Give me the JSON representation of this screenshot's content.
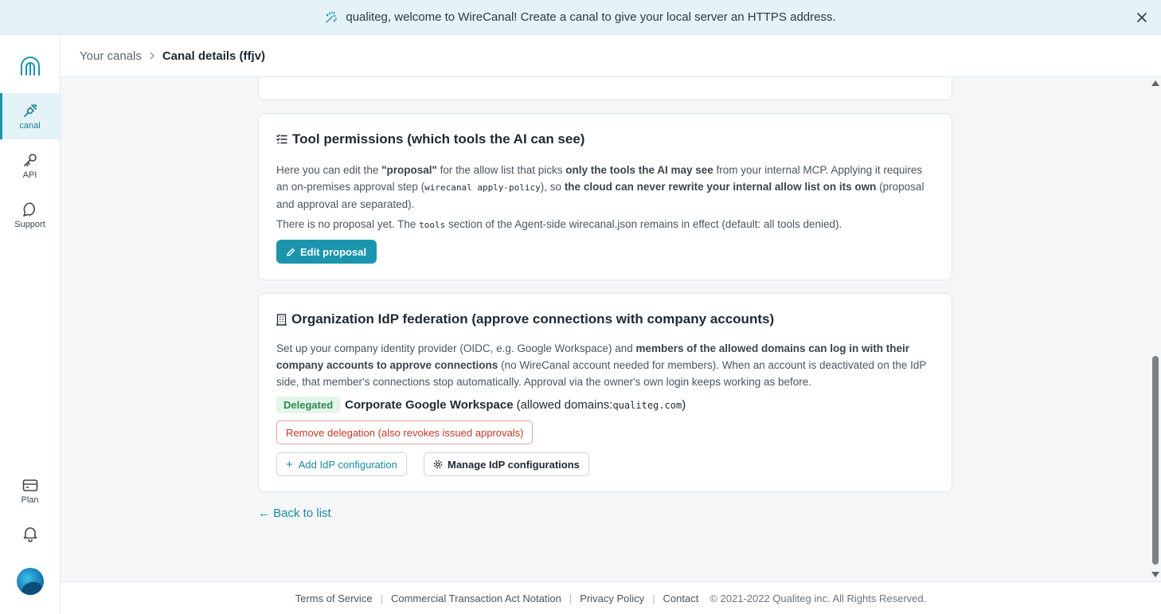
{
  "banner": {
    "message": "qualiteg, welcome to WireCanal! Create a canal to give your local server an HTTPS address."
  },
  "sidebar": {
    "items": [
      {
        "label": "canal",
        "icon": "plug-icon"
      },
      {
        "label": "API",
        "icon": "key-icon"
      },
      {
        "label": "Support",
        "icon": "chat-bubble-icon"
      },
      {
        "label": "Plan",
        "icon": "card-icon"
      }
    ]
  },
  "breadcrumb": {
    "parent": "Your canals",
    "current": "Canal details (ffjv)"
  },
  "tool_permissions": {
    "title": "Tool permissions (which tools the AI can see)",
    "p1_a": "Here you can edit the ",
    "p1_b": "\"proposal\"",
    "p1_c": " for the allow list that picks ",
    "p1_d": "only the tools the AI may see",
    "p1_e": " from your internal MCP. Applying it requires an on-premises approval step (",
    "p1_code": "wirecanal apply-policy",
    "p1_f": "), so ",
    "p1_g": "the cloud can never rewrite your internal allow list on its own",
    "p1_h": " (proposal and approval are separated).",
    "p2_a": "There is no proposal yet. The ",
    "p2_code": "tools",
    "p2_b": " section of the Agent-side wirecanal.json remains in effect (default: all tools denied).",
    "edit_button": "Edit proposal"
  },
  "idp": {
    "title": "Organization IdP federation (approve connections with company accounts)",
    "p1_a": "Set up your company identity provider (OIDC, e.g. Google Workspace) and ",
    "p1_b": "members of the allowed domains can log in with their company accounts to approve connections",
    "p1_c": " (no WireCanal account needed for members). When an account is deactivated on the IdP side, that member's connections stop automatically. Approval via the owner's own login keeps working as before.",
    "badge": "Delegated",
    "name": "Corporate Google Workspace",
    "domains_prefix": "(allowed domains: ",
    "domain": "qualiteg.com",
    "domains_suffix": ")",
    "remove_button": "Remove delegation (also revokes issued approvals)",
    "add_button": "Add IdP configuration",
    "manage_button": "Manage IdP configurations"
  },
  "back_link": "← Back to list",
  "footer": {
    "terms": "Terms of Service",
    "commercial": "Commercial Transaction Act Notation",
    "privacy": "Privacy Policy",
    "contact": "Contact",
    "copyright": "© 2021-2022 Qualiteg inc. All Rights Reserved."
  },
  "colors": {
    "accent": "#1b95ad",
    "banner_bg": "#e4f3f7",
    "danger": "#c0392b",
    "success": "#2f8a4d"
  }
}
